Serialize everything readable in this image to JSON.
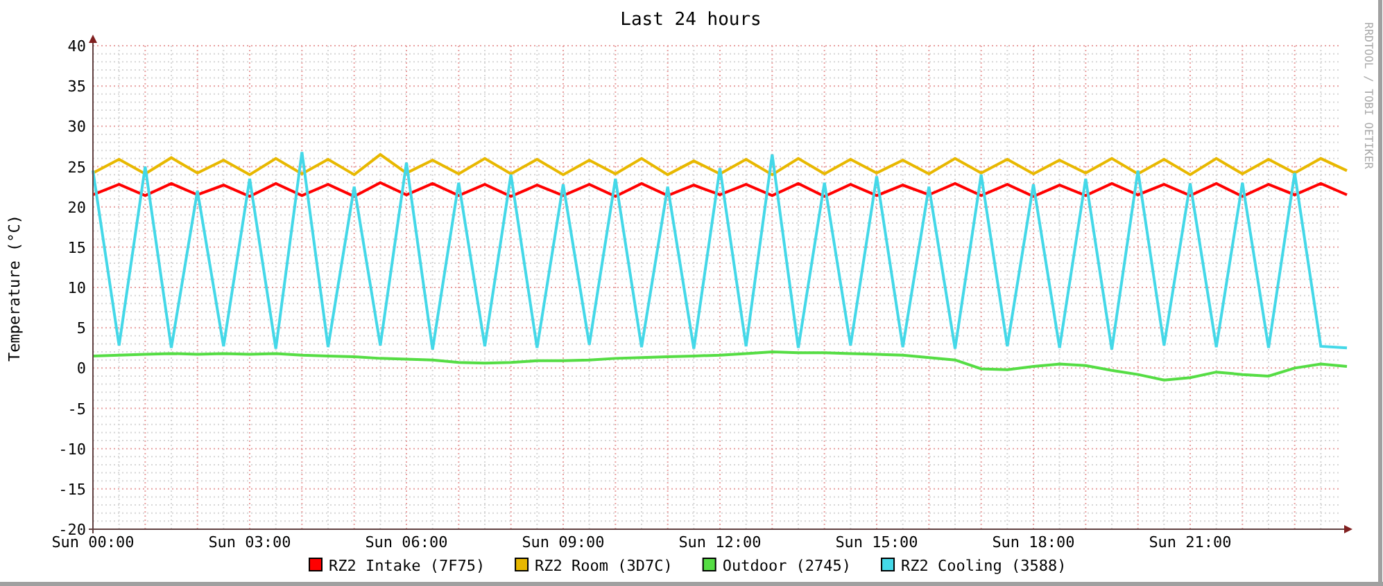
{
  "graph": {
    "signature": "RRDTOOL / TOBI OETIKER",
    "chart_data": {
      "type": "line",
      "title": "Last 24 hours",
      "ylabel": "Temperature (°C)",
      "categories": [
        "Sun 00:00",
        null,
        null,
        null,
        null,
        null,
        "Sun 03:00",
        null,
        null,
        null,
        null,
        null,
        "Sun 06:00",
        null,
        null,
        null,
        null,
        null,
        "Sun 09:00",
        null,
        null,
        null,
        null,
        null,
        "Sun 12:00",
        null,
        null,
        null,
        null,
        null,
        "Sun 15:00",
        null,
        null,
        null,
        null,
        null,
        "Sun 18:00",
        null,
        null,
        null,
        null,
        null,
        "Sun 21:00",
        null,
        null,
        null,
        null,
        null,
        null
      ],
      "ylim": [
        -20,
        40
      ],
      "grid": true,
      "legend": "bottom",
      "yticks": [
        -20,
        -15,
        -10,
        -5,
        0,
        5,
        10,
        15,
        20,
        25,
        30,
        35,
        40
      ],
      "series": [
        {
          "name": "RZ2 Intake (7F75)",
          "color": "#ff0000",
          "values": [
            21.5,
            22.8,
            21.4,
            22.9,
            21.5,
            22.7,
            21.3,
            22.9,
            21.4,
            22.8,
            21.3,
            23.0,
            21.5,
            22.9,
            21.4,
            22.8,
            21.3,
            22.7,
            21.4,
            22.8,
            21.3,
            22.9,
            21.4,
            22.7,
            21.5,
            22.8,
            21.4,
            22.9,
            21.3,
            22.8,
            21.4,
            22.7,
            21.5,
            22.9,
            21.4,
            22.8,
            21.3,
            22.7,
            21.4,
            22.9,
            21.5,
            22.8,
            21.4,
            22.9,
            21.3,
            22.8,
            21.5,
            22.9,
            21.5
          ]
        },
        {
          "name": "RZ2 Room (3D7C)",
          "color": "#e8b800",
          "values": [
            24.2,
            25.9,
            24.1,
            26.1,
            24.2,
            25.8,
            24.0,
            26.0,
            24.1,
            25.9,
            24.0,
            26.5,
            24.2,
            25.8,
            24.1,
            26.0,
            24.1,
            25.9,
            24.0,
            25.8,
            24.1,
            26.0,
            24.0,
            25.7,
            24.1,
            25.9,
            24.0,
            26.0,
            24.1,
            25.9,
            24.2,
            25.8,
            24.1,
            26.0,
            24.2,
            25.9,
            24.1,
            25.8,
            24.2,
            26.0,
            24.1,
            25.9,
            24.0,
            26.0,
            24.1,
            25.9,
            24.2,
            26.0,
            24.5
          ]
        },
        {
          "name": "Outdoor (2745)",
          "color": "#55dd44",
          "values": [
            1.5,
            1.6,
            1.7,
            1.8,
            1.7,
            1.8,
            1.7,
            1.8,
            1.6,
            1.5,
            1.4,
            1.2,
            1.1,
            1.0,
            0.7,
            0.6,
            0.7,
            0.9,
            0.9,
            1.0,
            1.2,
            1.3,
            1.4,
            1.5,
            1.6,
            1.8,
            2.0,
            1.9,
            1.9,
            1.8,
            1.7,
            1.6,
            1.3,
            1.0,
            -0.1,
            -0.2,
            0.2,
            0.5,
            0.3,
            -0.3,
            -0.8,
            -1.5,
            -1.2,
            -0.5,
            -0.8,
            -1.0,
            0.0,
            0.5,
            0.2
          ]
        },
        {
          "name": "RZ2 Cooling (3588)",
          "color": "#44d8e8",
          "values": [
            24.5,
            2.8,
            25.0,
            2.5,
            22.0,
            2.7,
            23.5,
            2.4,
            26.8,
            2.6,
            22.5,
            2.8,
            25.5,
            2.3,
            23.0,
            2.7,
            24.0,
            2.5,
            22.8,
            2.9,
            23.5,
            2.6,
            22.5,
            2.4,
            24.8,
            2.7,
            26.5,
            2.5,
            23.0,
            2.8,
            23.8,
            2.6,
            22.5,
            2.4,
            24.0,
            2.7,
            22.8,
            2.5,
            23.5,
            2.3,
            24.5,
            2.8,
            22.9,
            2.6,
            23.0,
            2.5,
            24.2,
            2.7,
            2.5
          ]
        }
      ]
    }
  }
}
